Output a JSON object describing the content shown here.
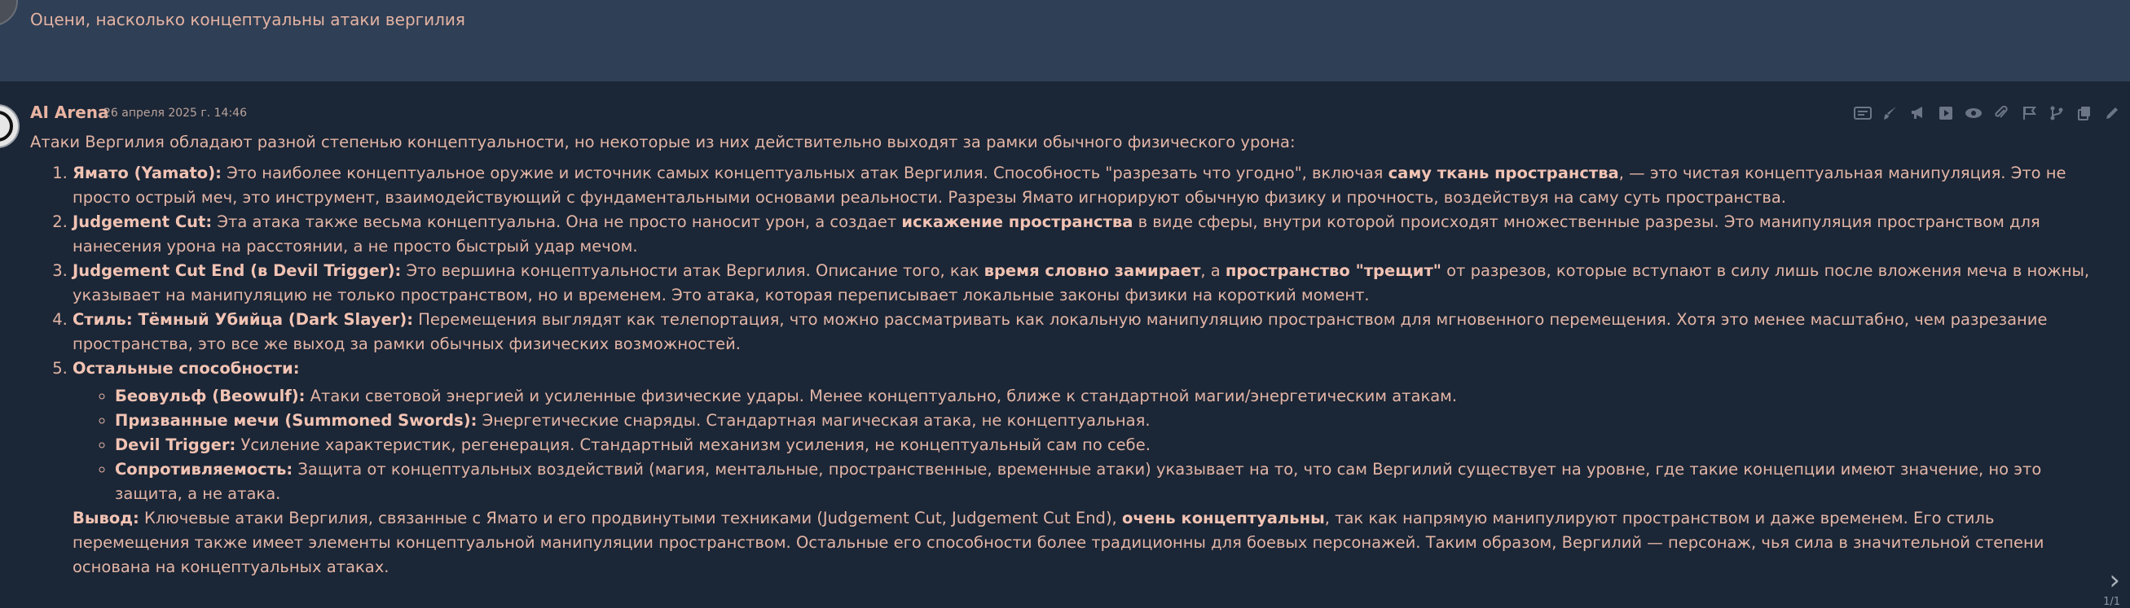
{
  "user": {
    "message": "Оцени, насколько концептуальны атаки вергилия"
  },
  "ai": {
    "name": "AI Arena",
    "date": "26 апреля 2025 г. 14:46",
    "intro": "Атаки Вергилия обладают разной степенью концептуальности, но некоторые из них действительно выходят за рамки обычного физического урона:",
    "items": [
      {
        "title": "Ямато (Yamato):",
        "t1": " Это наиболее концептуальное оружие и источник самых концептуальных атак Вергилия. Способность \"разрезать что угодно\", включая ",
        "b1": "саму ткань пространства",
        "t2": ", — это чистая концептуальная манипуляция. Это не просто острый меч, это инструмент, взаимодействующий с фундаментальными основами реальности. Разрезы Ямато игнорируют обычную физику и прочность, воздействуя на саму суть пространства."
      },
      {
        "title": "Judgement Cut:",
        "t1": " Эта атака также весьма концептуальна. Она не просто наносит урон, а создает ",
        "b1": "искажение пространства",
        "t2": " в виде сферы, внутри которой происходят множественные разрезы. Это манипуляция пространством для нанесения урона на расстоянии, а не просто быстрый удар мечом."
      },
      {
        "title": "Judgement Cut End (в Devil Trigger):",
        "t1": " Это вершина концептуальности атак Вергилия. Описание того, как ",
        "b1": "время словно замирает",
        "t2": ", а ",
        "b2": "пространство \"трещит\"",
        "t3": " от разрезов, которые вступают в силу лишь после вложения меча в ножны, указывает на манипуляцию не только пространством, но и временем. Это атака, которая переписывает локальные законы физики на короткий момент."
      },
      {
        "title": "Стиль: Тёмный Убийца (Dark Slayer):",
        "t1": " Перемещения выглядят как телепортация, что можно рассматривать как локальную манипуляцию пространством для мгновенного перемещения. Хотя это менее масштабно, чем разрезание пространства, это все же выход за рамки обычных физических возможностей."
      },
      {
        "title": "Остальные способности:"
      }
    ],
    "subitems": [
      {
        "title": "Беовульф (Beowulf):",
        "text": " Атаки световой энергией и усиленные физические удары. Менее концептуально, ближе к стандартной магии/энергетическим атакам."
      },
      {
        "title": "Призванные мечи (Summoned Swords):",
        "text": " Энергетические снаряды. Стандартная магическая атака, не концептуальная."
      },
      {
        "title": "Devil Trigger:",
        "text": " Усиление характеристик, регенерация. Стандартный механизм усиления, не концептуальный сам по себе."
      },
      {
        "title": "Сопротивляемость:",
        "text": " Защита от концептуальных воздействий (магия, ментальные, пространственные, временные атаки) указывает на то, что сам Вергилий существует на уровне, где такие концепции имеют значение, но это защита, а не атака."
      }
    ],
    "conclusion": {
      "title": "Вывод:",
      "t1": " Ключевые атаки Вергилия, связанные с Ямато и его продвинутыми техниками (Judgement Cut, Judgement Cut End), ",
      "b1": "очень концептуальны",
      "t2": ", так как напрямую манипулируют пространством и даже временем. Его стиль перемещения также имеет элементы концептуальной манипуляции пространством. Остальные его способности более традиционны для боевых персонажей. Таким образом, Вергилий — персонаж, чья сила в значительной степени основана на концептуальных атаках."
    },
    "pager": "1/1"
  },
  "toolbar_icons": [
    "text-icon",
    "brush-icon",
    "megaphone-icon",
    "play-icon",
    "eye-icon",
    "paperclip-icon",
    "flag-icon",
    "branch-icon",
    "copy-icon",
    "edit-icon"
  ],
  "colors": {
    "accent_text": "#e3b5a5",
    "user_bg": "#2f3f55",
    "ai_bg": "#1b2636"
  }
}
